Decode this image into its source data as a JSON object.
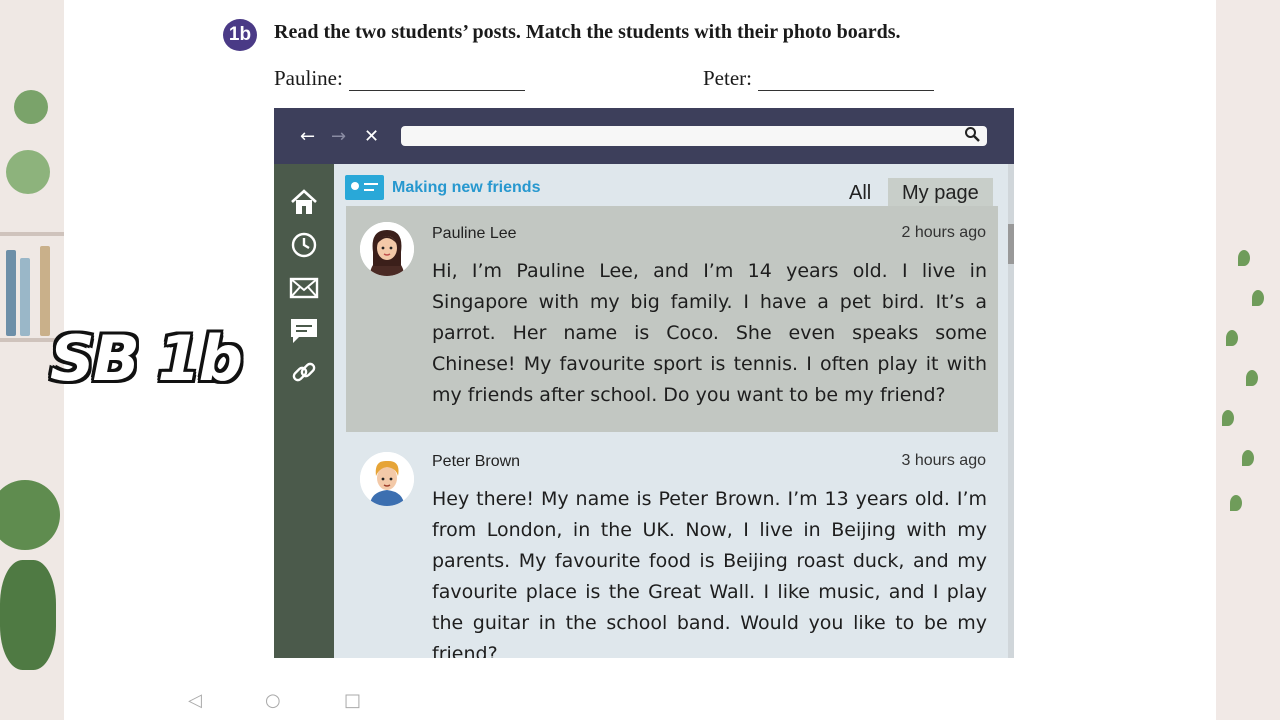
{
  "overlay_label": "SB 1b",
  "task": {
    "badge": "1b",
    "instruction": "Read the two students’ posts. Match the students with their photo boards."
  },
  "answers": [
    {
      "label": "Pauline:"
    },
    {
      "label": "Peter:"
    }
  ],
  "browser": {
    "nav": {
      "back": "←",
      "forward": "→",
      "close": "✕"
    },
    "search_icon": "search-icon",
    "sidebar_icons": [
      "home-icon",
      "clock-icon",
      "mail-icon",
      "chat-icon",
      "link-icon"
    ],
    "group_title": "Making new friends",
    "tabs": {
      "all": "All",
      "my_page": "My page"
    },
    "posts": [
      {
        "author": "Pauline Lee",
        "time": "2 hours ago",
        "body": "Hi, I’m Pauline Lee, and I’m 14 years old. I live in Singapore with my big family. I have a pet bird. It’s a parrot. Her name is Coco. She even speaks some Chinese! My favourite sport is tennis. I often play it with my friends after school. Do you want to be my friend?"
      },
      {
        "author": "Peter Brown",
        "time": "3  hours ago",
        "body": "Hey there! My name is Peter Brown. I’m 13 years old. I’m from London, in the UK. Now, I live in Beijing with my parents. My favourite food is Beijing roast duck, and my favourite place is the Great Wall. I like music, and I play the guitar in the school band. Would you like to be my friend?"
      }
    ]
  },
  "system_nav": {
    "back": "◁",
    "home": "○",
    "recents": "□"
  }
}
